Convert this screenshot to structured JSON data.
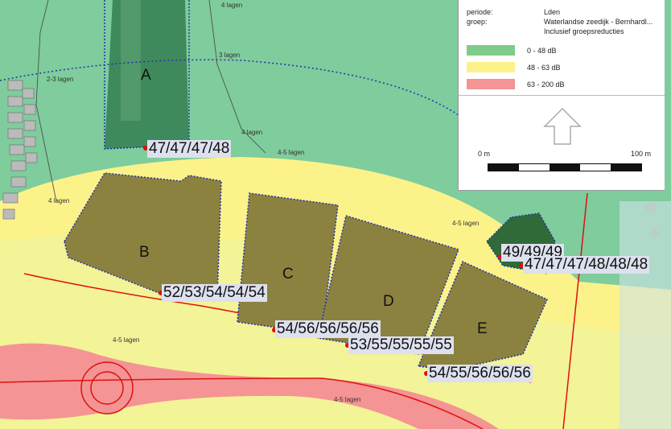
{
  "legend": {
    "periode_label": "periode:",
    "periode_value": "Lden",
    "groep_label": "groep:",
    "groep_value": "Waterlandse zeedijk - Bernhardl...",
    "groep_note": "Inclusief groepsreducties",
    "classes": [
      {
        "label": "0 - 48 dB",
        "color": "#7fcc8a"
      },
      {
        "label": "48 - 63 dB",
        "color": "#fbf28a"
      },
      {
        "label": "63 - 200 dB",
        "color": "#f49494"
      }
    ],
    "scale_start": "0 m",
    "scale_end": "100 m"
  },
  "blocks": {
    "a": "A",
    "b": "B",
    "c": "C",
    "d": "D",
    "e": "E"
  },
  "receptors": {
    "r1": "47/47/47/48",
    "r2": "52/53/54/54/54",
    "r3": "54/56/56/56/56",
    "r4": "53/55/55/55/55",
    "r5": "54/55/56/56/56",
    "r6": "49/49/49",
    "r7": "47/47/47/48/48/48"
  },
  "storeys": {
    "s1": "4 lagen",
    "s2": "3 lagen",
    "s3": "2-3 lagen",
    "s4": "4 lagen",
    "s5": "4-5 lagen",
    "s6": "4 lagen",
    "s7": "4-5 lagen",
    "s8": "4-5 lagen",
    "s9": "4-5 lagen"
  }
}
